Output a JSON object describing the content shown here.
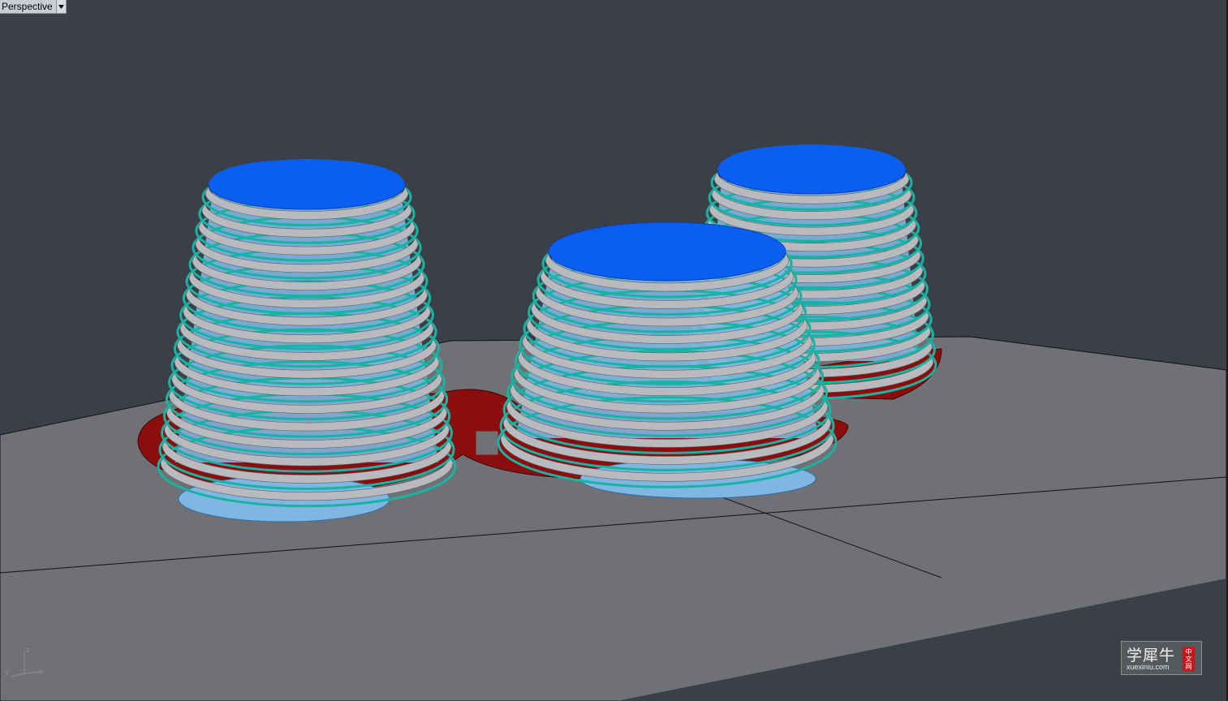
{
  "viewport": {
    "title": "Perspective",
    "menu_icon": "dropdown-arrow-icon",
    "background": "#3b4048"
  },
  "scene": {
    "ground_color": "#6f7073",
    "roof_color": "#0b5ff0",
    "floor_slab_color": "#b8babd",
    "slab_edge_color": "#18b3a2",
    "glass_color": "#7fb6e2",
    "podium_color": "#8a0e0e"
  },
  "axis": {
    "z_label": "z",
    "y_label": "y",
    "x_label": "x"
  },
  "watermark": {
    "brand_cn": "学犀牛",
    "url": "xuexiniu.com",
    "seal_text": [
      "中",
      "文",
      "网"
    ]
  }
}
